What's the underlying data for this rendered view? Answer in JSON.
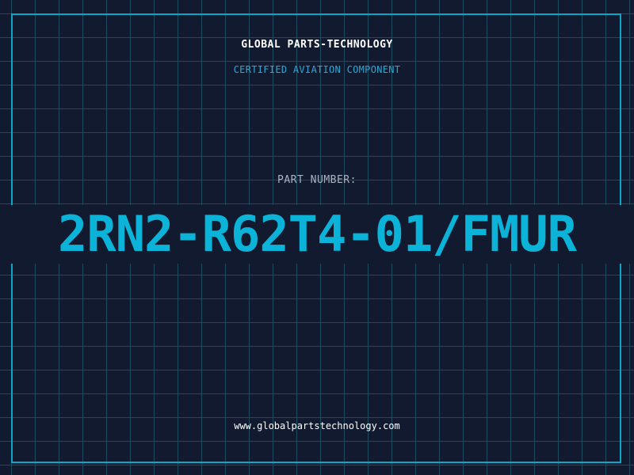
{
  "company": "GLOBAL PARTS-TECHNOLOGY",
  "tagline": "CERTIFIED AVIATION COMPONENT",
  "part_number_label": "PART NUMBER:",
  "part_number": "2RN2-R62T4-01/FMUR",
  "website": "www.globalpartstechnology.com",
  "colors": {
    "background": "#111a2e",
    "grid": "#1e4a5e",
    "accent": "#0cb3d9",
    "frame": "#0aa7c8",
    "label": "#a8b4c4",
    "text": "#ffffff"
  }
}
